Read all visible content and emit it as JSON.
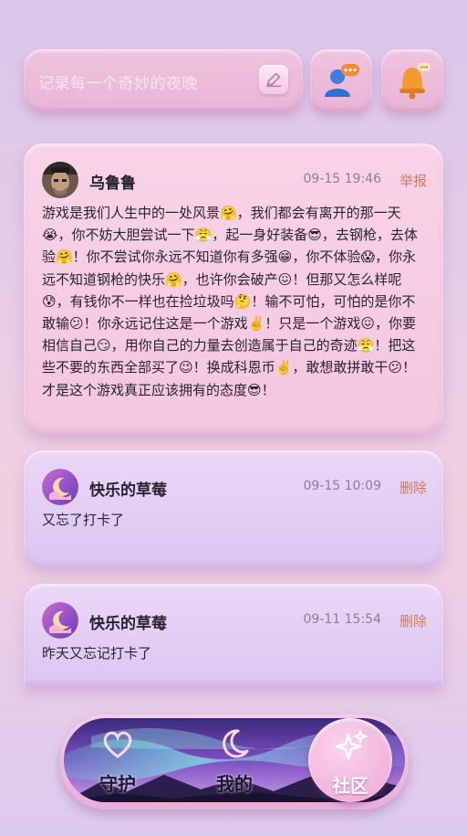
{
  "search": {
    "placeholder": "记录每一个奇妙的夜晚"
  },
  "posts": [
    {
      "username": "乌鲁鲁",
      "time": "09-15 19:46",
      "action": "举报",
      "content": "游戏是我们人生中的一处风景🤗，我们都会有离开的那一天😭，你不妨大胆尝试一下😤，起一身好装备😎，去钢枪，去体验🤗！你不尝试你永远不知道你有多强😁，你不体验😱，你永远不知道钢枪的快乐🤗，也许你会破产😖！但那又怎么样呢😰，有钱你不一样也在捡垃圾吗🤔！输不可怕，可怕的是你不敢输😕！你永远记住这是一个游戏✌️！只是一个游戏😖，你要相信自己😏，用你自己的力量去创造属于自己的奇迹😤！把这些不要的东西全部买了😉！换成科恩币✌️，敢想敢拼敢干😕！才是这个游戏真正应该拥有的态度😎！"
    },
    {
      "username": "快乐的草莓",
      "time": "09-15 10:09",
      "action": "删除",
      "content": "又忘了打卡了"
    },
    {
      "username": "快乐的草莓",
      "time": "09-11 15:54",
      "action": "删除",
      "content": "昨天又忘记打卡了"
    }
  ],
  "tabs": [
    {
      "label": "守护",
      "icon": "heart-icon"
    },
    {
      "label": "我的",
      "icon": "moon-icon"
    },
    {
      "label": "社区",
      "icon": "sparkle-icon",
      "active": true
    }
  ],
  "colors": {
    "accent_action": "#d07a5a",
    "card_pink": "#f6cfe3",
    "card_lilac": "#e3cff4"
  }
}
